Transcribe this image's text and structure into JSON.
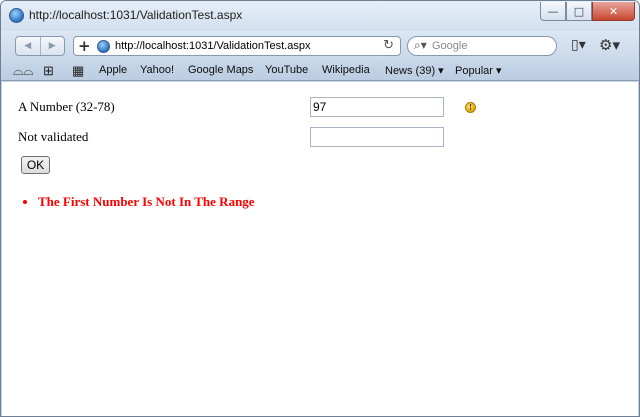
{
  "window": {
    "title": "http://localhost:1031/ValidationTest.aspx",
    "controls": {
      "minimize": "—",
      "maximize": "□",
      "close": "✕"
    }
  },
  "toolbar": {
    "back_glyph": "◀",
    "forward_glyph": "▶",
    "new_tab_glyph": "+",
    "url": "http://localhost:1031/ValidationTest.aspx",
    "reload_glyph": "↻",
    "search_placeholder": "Google",
    "search_glyph": "🔍",
    "page_menu_glyph": "▯▾",
    "settings_menu_glyph": "⚙▾"
  },
  "bookmarks": {
    "reading_list_glyph": "👓",
    "bookmarks_glyph": "📖",
    "top_sites_glyph": "▦",
    "items": [
      "Apple",
      "Yahoo!",
      "Google Maps",
      "YouTube",
      "Wikipedia",
      "News (39) ▾",
      "Popular ▾"
    ]
  },
  "form": {
    "field1_label": "A Number (32-78)",
    "field1_value": "97",
    "field2_label": "Not validated",
    "field2_value": "",
    "warning_glyph": "!",
    "submit_label": "OK"
  },
  "validation_summary": {
    "errors": [
      "The First Number Is Not In The Range"
    ],
    "color": "#ff0000"
  },
  "icons": {
    "browser": "globe-icon",
    "warning": "warning-icon",
    "search": "search-icon",
    "settings": "gear-icon"
  }
}
